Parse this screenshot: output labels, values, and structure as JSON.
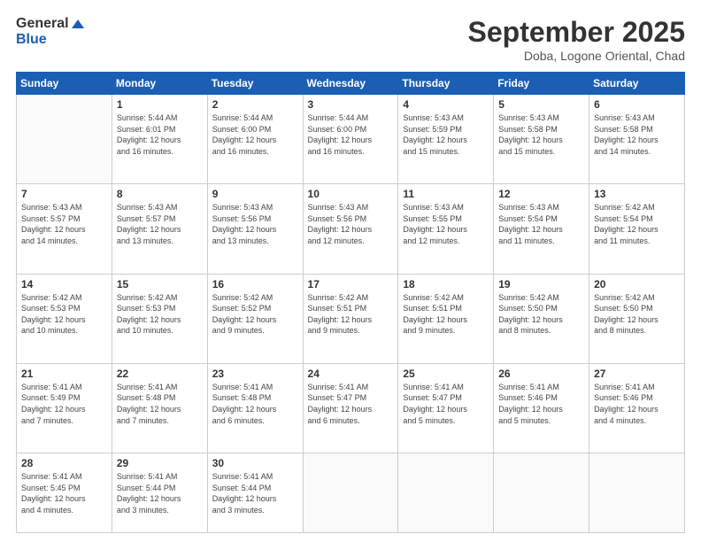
{
  "logo": {
    "line1": "General",
    "line2": "Blue"
  },
  "header": {
    "month": "September 2025",
    "location": "Doba, Logone Oriental, Chad"
  },
  "days_of_week": [
    "Sunday",
    "Monday",
    "Tuesday",
    "Wednesday",
    "Thursday",
    "Friday",
    "Saturday"
  ],
  "weeks": [
    [
      {
        "day": "",
        "info": ""
      },
      {
        "day": "1",
        "info": "Sunrise: 5:44 AM\nSunset: 6:01 PM\nDaylight: 12 hours\nand 16 minutes."
      },
      {
        "day": "2",
        "info": "Sunrise: 5:44 AM\nSunset: 6:00 PM\nDaylight: 12 hours\nand 16 minutes."
      },
      {
        "day": "3",
        "info": "Sunrise: 5:44 AM\nSunset: 6:00 PM\nDaylight: 12 hours\nand 16 minutes."
      },
      {
        "day": "4",
        "info": "Sunrise: 5:43 AM\nSunset: 5:59 PM\nDaylight: 12 hours\nand 15 minutes."
      },
      {
        "day": "5",
        "info": "Sunrise: 5:43 AM\nSunset: 5:58 PM\nDaylight: 12 hours\nand 15 minutes."
      },
      {
        "day": "6",
        "info": "Sunrise: 5:43 AM\nSunset: 5:58 PM\nDaylight: 12 hours\nand 14 minutes."
      }
    ],
    [
      {
        "day": "7",
        "info": "Sunrise: 5:43 AM\nSunset: 5:57 PM\nDaylight: 12 hours\nand 14 minutes."
      },
      {
        "day": "8",
        "info": "Sunrise: 5:43 AM\nSunset: 5:57 PM\nDaylight: 12 hours\nand 13 minutes."
      },
      {
        "day": "9",
        "info": "Sunrise: 5:43 AM\nSunset: 5:56 PM\nDaylight: 12 hours\nand 13 minutes."
      },
      {
        "day": "10",
        "info": "Sunrise: 5:43 AM\nSunset: 5:56 PM\nDaylight: 12 hours\nand 12 minutes."
      },
      {
        "day": "11",
        "info": "Sunrise: 5:43 AM\nSunset: 5:55 PM\nDaylight: 12 hours\nand 12 minutes."
      },
      {
        "day": "12",
        "info": "Sunrise: 5:43 AM\nSunset: 5:54 PM\nDaylight: 12 hours\nand 11 minutes."
      },
      {
        "day": "13",
        "info": "Sunrise: 5:42 AM\nSunset: 5:54 PM\nDaylight: 12 hours\nand 11 minutes."
      }
    ],
    [
      {
        "day": "14",
        "info": "Sunrise: 5:42 AM\nSunset: 5:53 PM\nDaylight: 12 hours\nand 10 minutes."
      },
      {
        "day": "15",
        "info": "Sunrise: 5:42 AM\nSunset: 5:53 PM\nDaylight: 12 hours\nand 10 minutes."
      },
      {
        "day": "16",
        "info": "Sunrise: 5:42 AM\nSunset: 5:52 PM\nDaylight: 12 hours\nand 9 minutes."
      },
      {
        "day": "17",
        "info": "Sunrise: 5:42 AM\nSunset: 5:51 PM\nDaylight: 12 hours\nand 9 minutes."
      },
      {
        "day": "18",
        "info": "Sunrise: 5:42 AM\nSunset: 5:51 PM\nDaylight: 12 hours\nand 9 minutes."
      },
      {
        "day": "19",
        "info": "Sunrise: 5:42 AM\nSunset: 5:50 PM\nDaylight: 12 hours\nand 8 minutes."
      },
      {
        "day": "20",
        "info": "Sunrise: 5:42 AM\nSunset: 5:50 PM\nDaylight: 12 hours\nand 8 minutes."
      }
    ],
    [
      {
        "day": "21",
        "info": "Sunrise: 5:41 AM\nSunset: 5:49 PM\nDaylight: 12 hours\nand 7 minutes."
      },
      {
        "day": "22",
        "info": "Sunrise: 5:41 AM\nSunset: 5:48 PM\nDaylight: 12 hours\nand 7 minutes."
      },
      {
        "day": "23",
        "info": "Sunrise: 5:41 AM\nSunset: 5:48 PM\nDaylight: 12 hours\nand 6 minutes."
      },
      {
        "day": "24",
        "info": "Sunrise: 5:41 AM\nSunset: 5:47 PM\nDaylight: 12 hours\nand 6 minutes."
      },
      {
        "day": "25",
        "info": "Sunrise: 5:41 AM\nSunset: 5:47 PM\nDaylight: 12 hours\nand 5 minutes."
      },
      {
        "day": "26",
        "info": "Sunrise: 5:41 AM\nSunset: 5:46 PM\nDaylight: 12 hours\nand 5 minutes."
      },
      {
        "day": "27",
        "info": "Sunrise: 5:41 AM\nSunset: 5:46 PM\nDaylight: 12 hours\nand 4 minutes."
      }
    ],
    [
      {
        "day": "28",
        "info": "Sunrise: 5:41 AM\nSunset: 5:45 PM\nDaylight: 12 hours\nand 4 minutes."
      },
      {
        "day": "29",
        "info": "Sunrise: 5:41 AM\nSunset: 5:44 PM\nDaylight: 12 hours\nand 3 minutes."
      },
      {
        "day": "30",
        "info": "Sunrise: 5:41 AM\nSunset: 5:44 PM\nDaylight: 12 hours\nand 3 minutes."
      },
      {
        "day": "",
        "info": ""
      },
      {
        "day": "",
        "info": ""
      },
      {
        "day": "",
        "info": ""
      },
      {
        "day": "",
        "info": ""
      }
    ]
  ]
}
